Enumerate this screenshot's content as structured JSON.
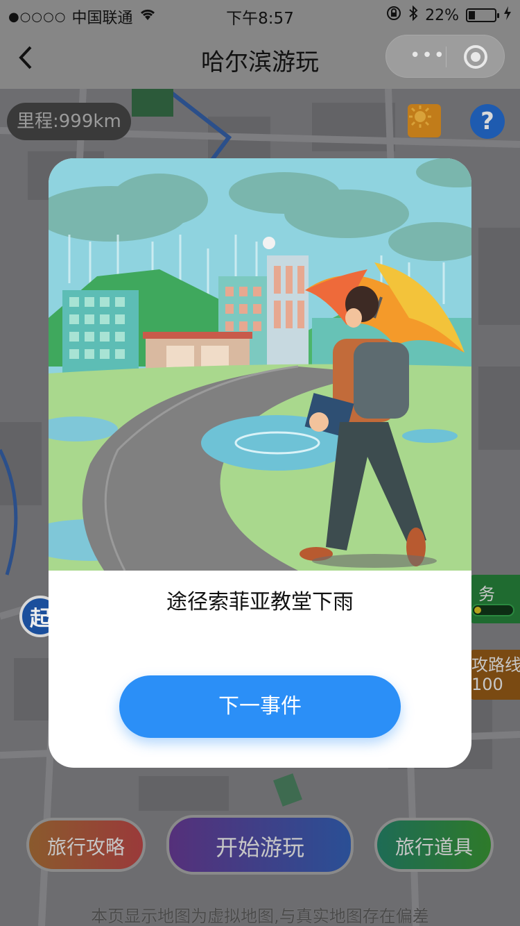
{
  "status_bar": {
    "signal": "●○○○○",
    "carrier": "中国联通",
    "time": "下午8:57",
    "battery": "22%"
  },
  "nav": {
    "title": "哈尔滨游玩"
  },
  "map": {
    "mileage": "里程:999km",
    "help_label": "?",
    "start_marker": "起",
    "task_label": "务",
    "route_label_line1": "攻路线",
    "route_label_line2": "100",
    "bottom_buttons": {
      "guide": "旅行攻略",
      "start": "开始游玩",
      "props": "旅行道具"
    },
    "disclaimer": "本页显示地图为虚拟地图,与真实地图存在偏差"
  },
  "modal": {
    "event_text": "途径索菲亚教堂下雨",
    "next_button": "下一事件"
  },
  "colors": {
    "primary_button": "#2b8ff7",
    "modal_bg": "#ffffff"
  }
}
